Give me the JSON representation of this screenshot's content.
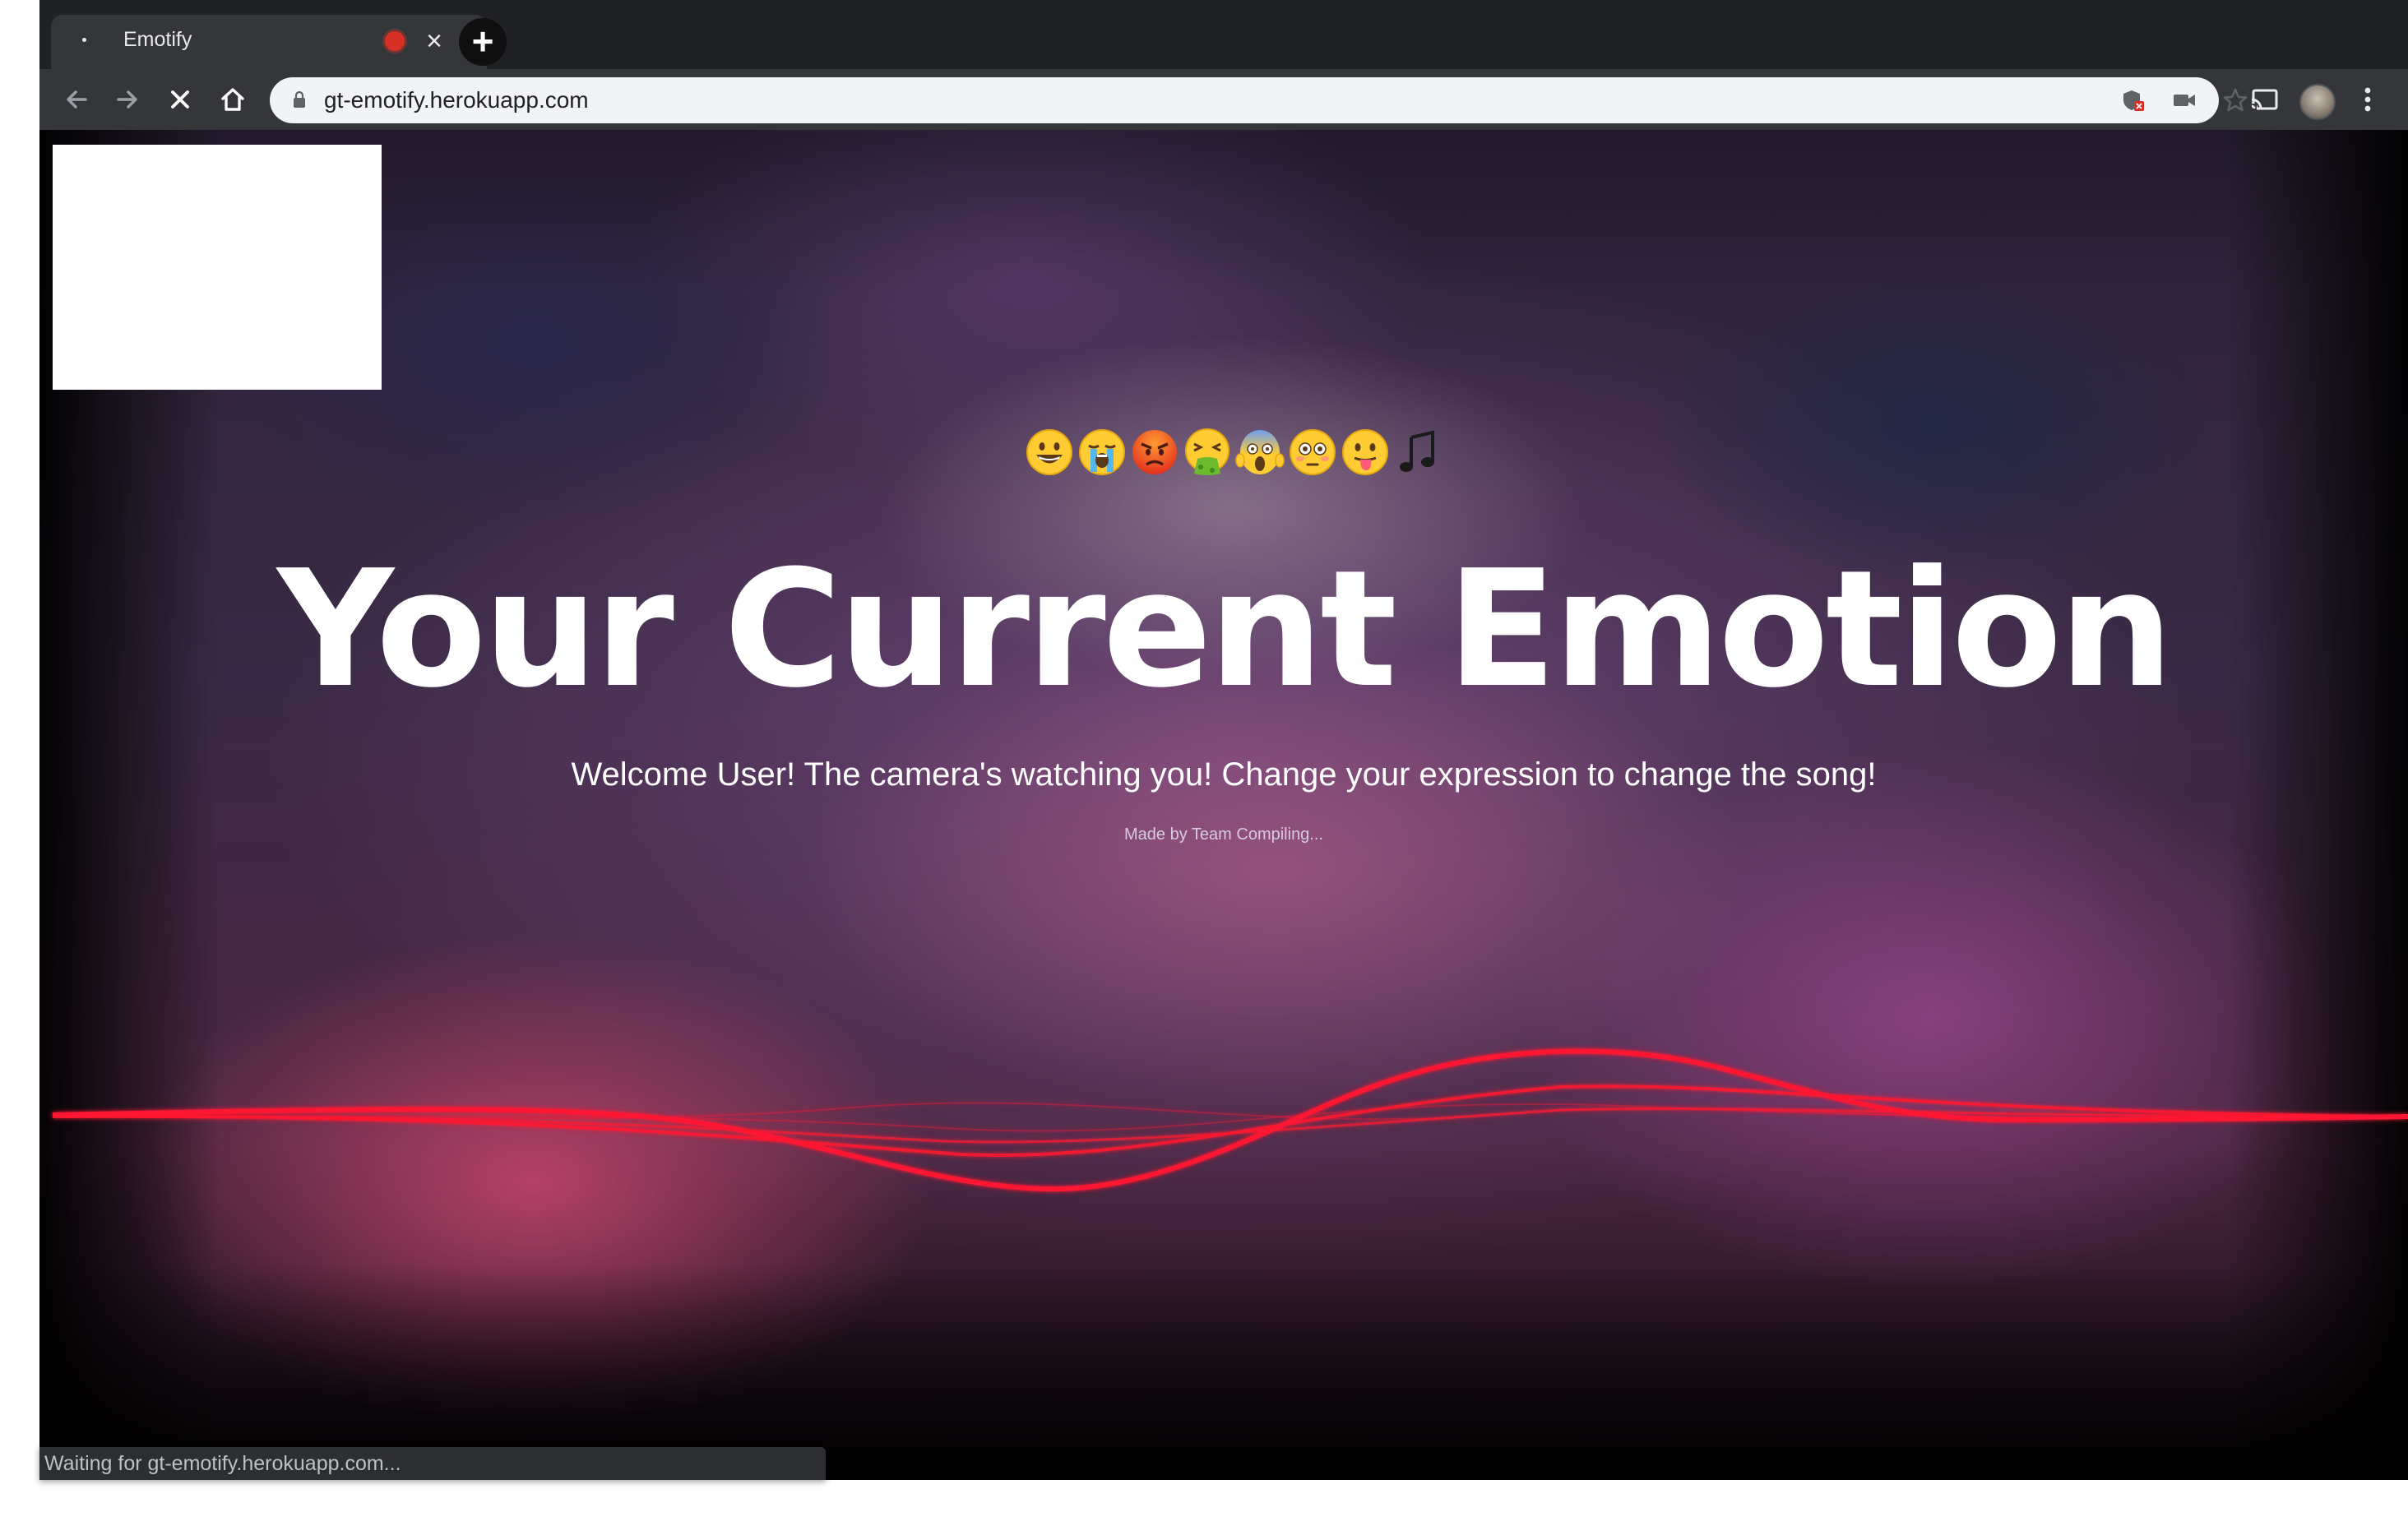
{
  "browser": {
    "tab": {
      "title": "Emotify",
      "favicon": "page-dot-icon",
      "recording_indicator": "recording-dot-icon",
      "close": "close-icon"
    },
    "new_tab": "plus-icon",
    "toolbar": {
      "back": "arrow-left-icon",
      "forward": "arrow-right-icon",
      "stop": "stop-loading-x-icon",
      "home": "home-icon",
      "url": "gt-emotify.herokuapp.com",
      "lock": "lock-icon",
      "omnibox_icons": [
        "shield-blocked-icon",
        "camera-in-use-icon",
        "star-bookmark-icon"
      ],
      "right_icons": [
        "cast-icon",
        "profile-avatar",
        "kebab-menu-icon"
      ]
    },
    "status_bar": "Waiting for gt-emotify.herokuapp.com..."
  },
  "page": {
    "emojis": [
      "😀",
      "😭",
      "😡",
      "🤮",
      "😱",
      "😳",
      "😛",
      "🎵"
    ],
    "headline": "Your Current Emotion",
    "subheading": "Welcome User! The camera's watching you! Change your expression to change the song!",
    "credit": "Made by Team Compiling...",
    "colors": {
      "wave": "#ff1830",
      "headline": "#ffffff"
    }
  }
}
